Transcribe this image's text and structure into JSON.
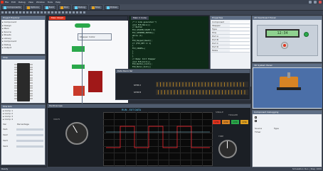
{
  "menubar": {
    "items": [
      "File",
      "Edit",
      "Debug",
      "View",
      "Window",
      "Tools",
      "Help"
    ]
  },
  "toolbar": {
    "labels": [
      "Components",
      "Options",
      "Build",
      "Run",
      "Debug",
      "Stop",
      "Probes"
    ]
  },
  "project": {
    "title": "Project Explorer",
    "items": [
      "Component",
      "Design",
      "Main",
      "Source",
      "Sheets",
      "Library",
      "Component",
      "Debug",
      "Output"
    ]
  },
  "sheet": {
    "tab": "Main Sheet",
    "labels": [
      "Flowchart",
      "Stepper motor",
      "Variables",
      "Start",
      "Event"
    ]
  },
  "code": {
    "tab": "Main C Code",
    "lines": [
      "/* C Code generated */",
      "void FCM_Main(){",
      "  // Button",
      "  FCV_SYSTEM_STATE = 0;",
      "  FCI_STEPPER_MOTOR();",
      "  while (1)",
      "  {",
      "    FCD_Keypad_Read();",
      "    if (FCV_KEY == 1)",
      "    {",
      "      FCV_COUNT++;",
      "    }",
      "  }",
      "}",
      "// Name: Init Stepper",
      "void FCM_Init(){",
      "  FCD_Button_Init();",
      "  FCD_Motor_Init();",
      "}"
    ]
  },
  "properties": {
    "title": "Properties",
    "rows": [
      "Component",
      "Stepper",
      "Type",
      "Pins",
      "Port A",
      "Port B",
      "Port C",
      "Port D",
      "Mode"
    ]
  },
  "panel2d": {
    "title": "2D Dashboard Panel",
    "lcd": "12:34"
  },
  "panel3d": {
    "title": "3D System Panel"
  },
  "chip": {
    "title": "Chip"
  },
  "datarecorder": {
    "title": "Data Recorder",
    "chan1": "STEP A",
    "chan2": "STEP B"
  },
  "oscilloscope": {
    "title": "Oscilloscope",
    "header": "RUN - EXT DATA",
    "labels": [
      "VOLTS",
      "TIME",
      "SINGLE",
      "TRIGGER"
    ],
    "buttons": [
      "CH1",
      "CH2",
      "CH3",
      "CH4"
    ]
  },
  "ghost": {
    "title": "Component debugging",
    "cols": [
      "Source",
      "Type"
    ],
    "row": "Timer"
  },
  "bottomleft": {
    "title": "Pins Sim",
    "cols": [
      "Var",
      "Percentage"
    ],
    "rows": [
      "Var1",
      "Var2",
      "Var3",
      "Var4"
    ]
  },
  "status": {
    "left": "Ready",
    "right": "Simulation Run  |  Step 1000"
  },
  "colors": {
    "accent": "#e0341e",
    "green": "#2aa84a",
    "scopebg": "#0a0a0a",
    "scope": "#d2232a"
  }
}
